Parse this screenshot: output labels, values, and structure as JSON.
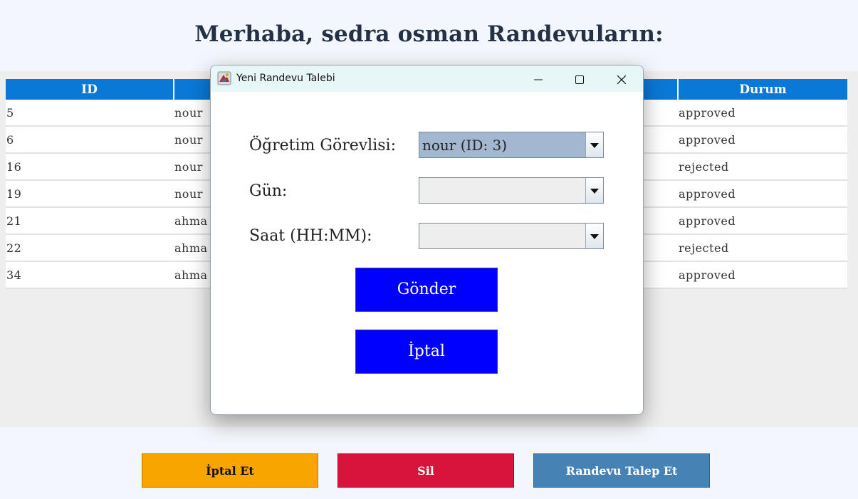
{
  "header": {
    "title": "Merhaba, sedra osman  Randevuların:"
  },
  "table": {
    "columns": [
      "ID",
      "",
      "",
      "",
      "Durum"
    ],
    "rows": [
      [
        "5",
        "nour",
        "",
        "",
        "approved"
      ],
      [
        "6",
        "nour",
        "",
        "",
        "approved"
      ],
      [
        "16",
        "nour",
        "",
        "",
        "rejected"
      ],
      [
        "19",
        "nour",
        "",
        "",
        "approved"
      ],
      [
        "21",
        "ahma",
        "",
        "",
        "approved"
      ],
      [
        "22",
        "ahma",
        "",
        "",
        "rejected"
      ],
      [
        "34",
        "ahma",
        "",
        "",
        "approved"
      ]
    ]
  },
  "footer": {
    "cancel_label": "İptal Et",
    "delete_label": "Sil",
    "request_label": "Randevu Talep Et"
  },
  "dialog": {
    "title": "Yeni Randevu Talebi",
    "lecturer_label": "Öğretim Görevlisi:",
    "lecturer_value": "nour (ID: 3)",
    "day_label": "Gün:",
    "day_value": "",
    "time_label": "Saat (HH:MM):",
    "time_value": "",
    "submit_label": "Gönder",
    "cancel_label": "İptal"
  },
  "colors": {
    "header_blue": "#0a78d7",
    "cancel_orange": "#f9a500",
    "delete_red": "#d8143a",
    "request_steel": "#4682b4",
    "dialog_button_blue": "#0000ff"
  },
  "icons": [
    "app-icon",
    "minimize-icon",
    "maximize-icon",
    "close-icon",
    "dropdown-arrow-icon"
  ]
}
